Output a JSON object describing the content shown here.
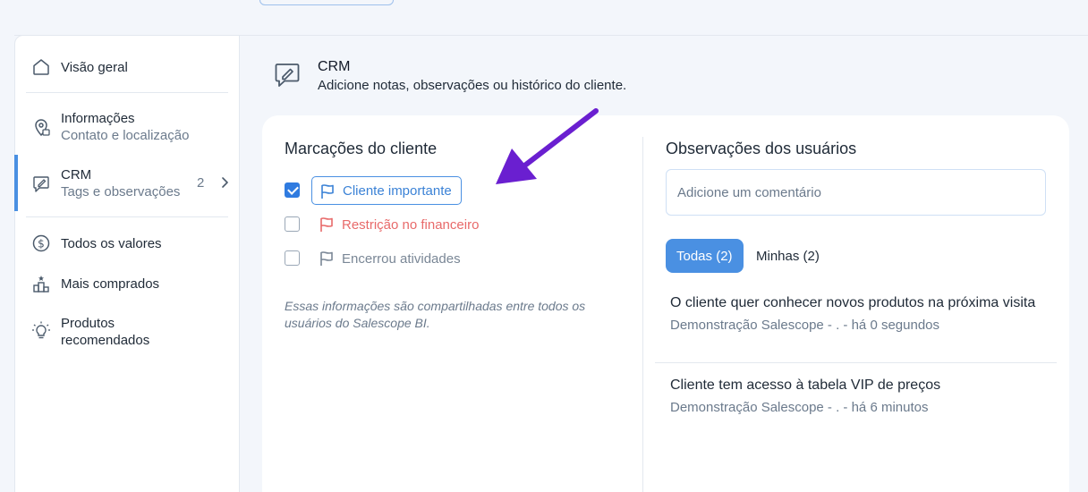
{
  "sidebar": {
    "items": [
      {
        "label": "Visão geral",
        "icon": "house-icon"
      },
      {
        "label": "Informações",
        "sub": "Contato e localização",
        "icon": "location-pin-icon"
      },
      {
        "label": "CRM",
        "sub": "Tags e observações",
        "badge": "2",
        "icon": "edit-note-icon",
        "active": true
      },
      {
        "label": "Todos os valores",
        "icon": "dollar-circle-icon"
      },
      {
        "label": "Mais comprados",
        "icon": "podium-icon"
      },
      {
        "label": "Produtos recomendados",
        "label_line1": "Produtos",
        "label_line2": "recomendados",
        "icon": "lightbulb-icon"
      }
    ]
  },
  "header": {
    "title": "CRM",
    "subtitle": "Adicione notas, observações ou histórico do cliente."
  },
  "tags_section": {
    "title": "Marcações do cliente",
    "tags": [
      {
        "label": "Cliente importante",
        "checked": true,
        "color": "#3b82d6"
      },
      {
        "label": "Restrição no financeiro",
        "checked": false,
        "color": "#e86a6a"
      },
      {
        "label": "Encerrou atividades",
        "checked": false,
        "color": "#7a8796"
      }
    ],
    "note": "Essas informações são compartilhadas entre todos os usuários do Salescope BI."
  },
  "observations": {
    "title": "Observações dos usuários",
    "input_placeholder": "Adicione um comentário",
    "tabs": [
      {
        "label": "Todas (2)",
        "active": true
      },
      {
        "label": "Minhas (2)",
        "active": false
      }
    ],
    "comments": [
      {
        "text": "O cliente quer conhecer novos produtos na próxima visita",
        "meta": "Demonstração Salescope - . - há 0 segundos"
      },
      {
        "text": "Cliente tem acesso à tabela VIP de preços",
        "meta": "Demonstração Salescope - . - há 6 minutos"
      }
    ]
  },
  "colors": {
    "accent": "#4a90e2",
    "arrow": "#6a1fd0",
    "muted": "#6b7a8c"
  }
}
